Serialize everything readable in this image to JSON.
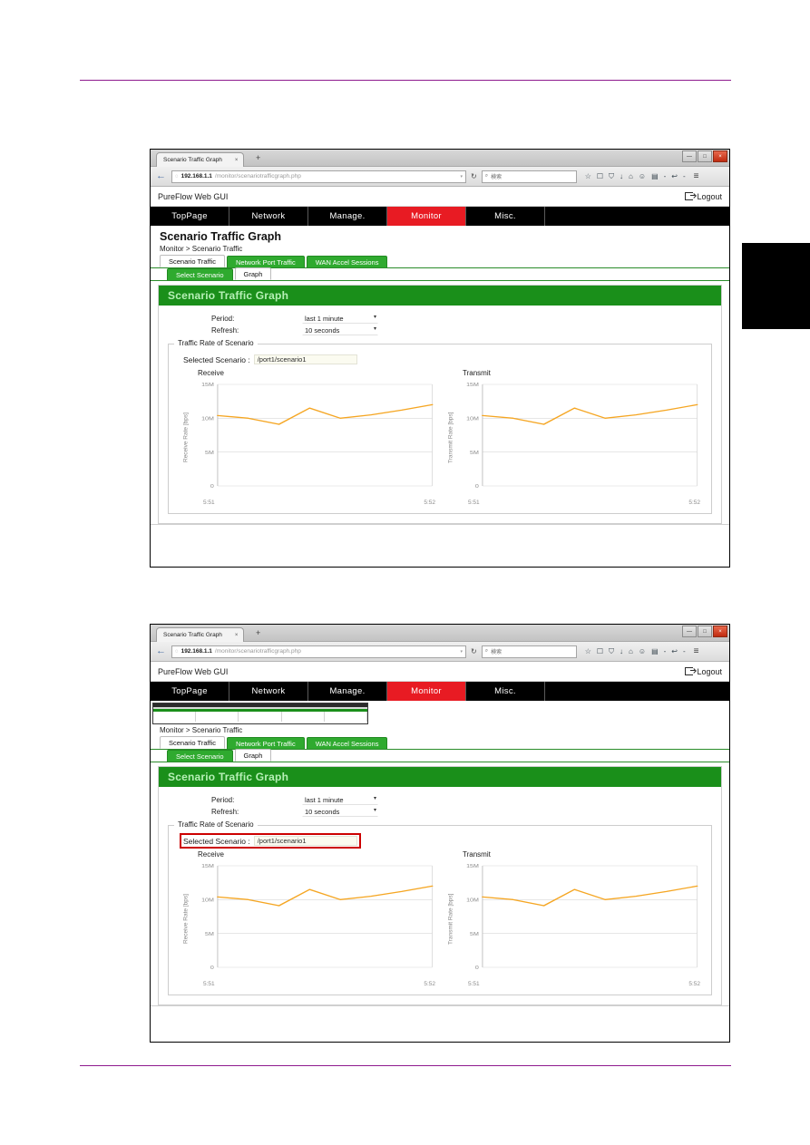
{
  "document": {
    "rule_color": "#8e1a8e",
    "chapter_tab_color": "#000000"
  },
  "browser": {
    "tab_title": "Scenario Traffic Graph",
    "tab_close": "×",
    "newtab": "+",
    "back_icon": "←",
    "url_host": "192.168.1.1",
    "url_path": "/monitor/scenariotrafficgraph.php",
    "url_globe": "◌",
    "url_caret": "▾",
    "reload_icon": "↻",
    "search_placeholder": "検索",
    "search_icon": "⌕",
    "toolbar_icons": [
      "☆",
      "☐",
      "⛉",
      "↓",
      "⌂",
      "☺",
      "▤",
      "-",
      "↩",
      "-"
    ],
    "hamburger": "≡",
    "window_buttons": [
      "—",
      "□",
      "×"
    ]
  },
  "app": {
    "brand": "PureFlow Web GUI",
    "logout_label": "Logout",
    "nav": [
      {
        "label": "TopPage",
        "active": false
      },
      {
        "label": "Network",
        "active": false
      },
      {
        "label": "Manage.",
        "active": false
      },
      {
        "label": "Monitor",
        "active": true
      },
      {
        "label": "Misc.",
        "active": false
      }
    ],
    "nav_active_color": "#e81b23",
    "page_title": "Scenario Traffic Graph",
    "breadcrumb": "Monitor > Scenario Traffic",
    "tabs": [
      {
        "label": "Scenario Traffic",
        "active": true
      },
      {
        "label": "Network Port Traffic",
        "active": false
      },
      {
        "label": "WAN Accel Sessions",
        "active": false
      }
    ],
    "subtabs": [
      {
        "label": "Select Scenario",
        "active": false
      },
      {
        "label": "Graph",
        "active": true
      }
    ],
    "tab_color": "#2faa2f",
    "panel": {
      "header": "Scenario Traffic Graph",
      "header_bg": "#1a8f1a",
      "header_fg": "#b6f0b6",
      "form": [
        {
          "label": "Period:",
          "value": "last 1 minute"
        },
        {
          "label": "Refresh:",
          "value": "10 seconds"
        }
      ],
      "group_legend": "Traffic Rate of Scenario",
      "scenario_label": "Selected Scenario :",
      "scenario_value": "/port1/scenario1",
      "highlight_color": "#cc0000"
    }
  },
  "chart_data": [
    {
      "type": "line",
      "title": "Receive",
      "ylabel": "Receive Rate [bps]",
      "xlabel": "",
      "ytick_labels": [
        "15M",
        "10M",
        "5M",
        "0"
      ],
      "ytick_values": [
        15000000,
        10000000,
        5000000,
        0
      ],
      "ylim": [
        0,
        15000000
      ],
      "xtick_labels": [
        "5:51",
        "5:52"
      ],
      "x": [
        0,
        1,
        2,
        3,
        4,
        5,
        6,
        7
      ],
      "values": [
        10400000,
        10000000,
        9100000,
        11500000,
        10000000,
        10500000,
        11200000,
        12000000
      ],
      "line_color": "#f5a623",
      "grid": true,
      "legend": false
    },
    {
      "type": "line",
      "title": "Transmit",
      "ylabel": "Transmit Rate [bps]",
      "xlabel": "",
      "ytick_labels": [
        "15M",
        "10M",
        "5M",
        "0"
      ],
      "ytick_values": [
        15000000,
        10000000,
        5000000,
        0
      ],
      "ylim": [
        0,
        15000000
      ],
      "xtick_labels": [
        "5:51",
        "5:52"
      ],
      "x": [
        0,
        1,
        2,
        3,
        4,
        5,
        6,
        7
      ],
      "values": [
        10400000,
        10000000,
        9100000,
        11500000,
        10000000,
        10500000,
        11200000,
        12000000
      ],
      "line_color": "#f5a623",
      "grid": true,
      "legend": false
    }
  ]
}
